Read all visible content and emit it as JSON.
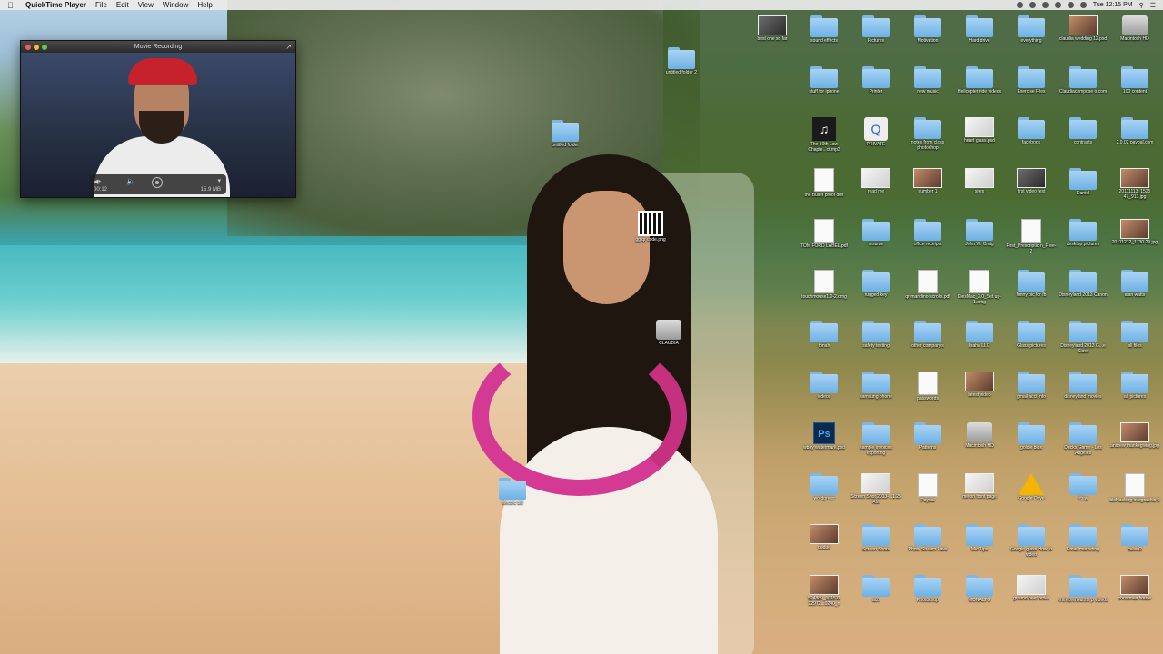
{
  "menubar": {
    "app_name": "QuickTime Player",
    "menus": [
      "File",
      "Edit",
      "View",
      "Window",
      "Help"
    ],
    "clock": "Tue 12:15 PM"
  },
  "movie_window": {
    "title": "Movie Recording",
    "elapsed": "00:12",
    "file_size": "15.9 MB"
  },
  "desktop_items": {
    "loose": [
      {
        "label": "untitled folder 2",
        "kind": "folder"
      },
      {
        "label": "untitled folder",
        "kind": "folder"
      },
      {
        "label": "gg qr code.png",
        "kind": "qr"
      },
      {
        "label": "CLAUDIA",
        "kind": "drive"
      },
      {
        "label": "electric bill",
        "kind": "folder"
      }
    ],
    "grid": [
      {
        "label": "best one so far",
        "kind": "thumb"
      },
      {
        "label": "sound effects",
        "kind": "folder"
      },
      {
        "label": "Pictures",
        "kind": "folder"
      },
      {
        "label": "Motivation",
        "kind": "folder"
      },
      {
        "label": "Hard drive",
        "kind": "folder"
      },
      {
        "label": "everything",
        "kind": "folder"
      },
      {
        "label": "claudia wedding 12.psd",
        "kind": "photo"
      },
      {
        "label": "Macintosh HD",
        "kind": "drive"
      },
      {
        "label": "stuff for iphone",
        "kind": "folder"
      },
      {
        "label": "Printer",
        "kind": "folder"
      },
      {
        "label": "new music",
        "kind": "folder"
      },
      {
        "label": "Helicopter ride videos",
        "kind": "folder"
      },
      {
        "label": "Exercise Files",
        "kind": "folder"
      },
      {
        "label": "Claudiacampose o.com",
        "kind": "folder"
      },
      {
        "label": "100 content",
        "kind": "folder"
      },
      {
        "label": "",
        "kind": "none"
      },
      {
        "label": "The 50th Law Chapte...ct.mp3",
        "kind": "music"
      },
      {
        "label": "PRIVATE",
        "kind": "quicktime"
      },
      {
        "label": "notes from class photoshop",
        "kind": "folder"
      },
      {
        "label": "heart glass.psd",
        "kind": "light"
      },
      {
        "label": "facebook",
        "kind": "folder"
      },
      {
        "label": "contracts",
        "kind": "folder"
      },
      {
        "label": "2.0.02 paypal.com",
        "kind": "folder"
      },
      {
        "label": "",
        "kind": "none"
      },
      {
        "label": "the Bullet proof diet",
        "kind": "doc"
      },
      {
        "label": "read me",
        "kind": "light"
      },
      {
        "label": "number 1",
        "kind": "photo"
      },
      {
        "label": "sites",
        "kind": "light"
      },
      {
        "label": "first video test",
        "kind": "thumb"
      },
      {
        "label": "Daniel",
        "kind": "folder"
      },
      {
        "label": "20111113_1525 47_913.jpg",
        "kind": "photo"
      },
      {
        "label": "",
        "kind": "none"
      },
      {
        "label": "TOM FORD LABEL.pdf",
        "kind": "doc"
      },
      {
        "label": "resume",
        "kind": "folder"
      },
      {
        "label": "office receipts",
        "kind": "folder"
      },
      {
        "label": "John W. Craig",
        "kind": "folder"
      },
      {
        "label": "First_Prescriptio n_Free-2",
        "kind": "doc"
      },
      {
        "label": "desktop pictures",
        "kind": "folder"
      },
      {
        "label": "20111212_1730 29.jpg",
        "kind": "photo"
      },
      {
        "label": "",
        "kind": "none"
      },
      {
        "label": "touchmouse1.0-2.dmg",
        "kind": "doc"
      },
      {
        "label": "rugged key",
        "kind": "folder"
      },
      {
        "label": "qr-mandino-scrolls.pdf",
        "kind": "doc"
      },
      {
        "label": "KiesMac_3.0_Set up-1.dmg",
        "kind": "doc"
      },
      {
        "label": "funny pic for fb",
        "kind": "folder"
      },
      {
        "label": "Disneyland 2013 Canon",
        "kind": "folder"
      },
      {
        "label": "alan watts",
        "kind": "folder"
      },
      {
        "label": "",
        "kind": "none"
      },
      {
        "label": "tonah",
        "kind": "folder"
      },
      {
        "label": "safety testing",
        "kind": "folder"
      },
      {
        "label": "other companys",
        "kind": "folder"
      },
      {
        "label": "Isaha LLC",
        "kind": "folder"
      },
      {
        "label": "Glass pictures",
        "kind": "folder"
      },
      {
        "label": "Disneyland 2013 G...e Glass",
        "kind": "folder"
      },
      {
        "label": "all files",
        "kind": "folder"
      },
      {
        "label": "",
        "kind": "none"
      },
      {
        "label": "videos",
        "kind": "folder"
      },
      {
        "label": "samsung phone",
        "kind": "folder"
      },
      {
        "label": "passwords",
        "kind": "doc"
      },
      {
        "label": "latest video",
        "kind": "photo"
      },
      {
        "label": "gmail acct info",
        "kind": "folder"
      },
      {
        "label": "disneyland movies",
        "kind": "folder"
      },
      {
        "label": "all pictures",
        "kind": "folder"
      },
      {
        "label": "",
        "kind": "none"
      },
      {
        "label": "wbay watermark.psd",
        "kind": "ps"
      },
      {
        "label": "sample invoices exporting",
        "kind": "folder"
      },
      {
        "label": "Patterns",
        "kind": "folder"
      },
      {
        "label": "Macintosh HD",
        "kind": "drive"
      },
      {
        "label": "goldie blox",
        "kind": "folder"
      },
      {
        "label": "Ducks Game - Los Angeles",
        "kind": "folder"
      },
      {
        "label": "andrew thanksgiving.jpg",
        "kind": "photo"
      },
      {
        "label": "",
        "kind": "none"
      },
      {
        "label": "wordpress",
        "kind": "folder"
      },
      {
        "label": "Screen Shot 2013-...1.25 AM",
        "kind": "light"
      },
      {
        "label": "Paypal",
        "kind": "doc"
      },
      {
        "label": "me on front page",
        "kind": "light"
      },
      {
        "label": "Google Drive",
        "kind": "gdrive"
      },
      {
        "label": "ebay",
        "kind": "folder"
      },
      {
        "label": "bioHacking-infographic-2",
        "kind": "doc"
      },
      {
        "label": "",
        "kind": "none"
      },
      {
        "label": "dudue",
        "kind": "photo"
      },
      {
        "label": "Screen Shots",
        "kind": "folder"
      },
      {
        "label": "Photo Stream Favs",
        "kind": "folder"
      },
      {
        "label": "Mic Tips",
        "kind": "folder"
      },
      {
        "label": "Google glass How to video",
        "kind": "folder"
      },
      {
        "label": "Email marketing",
        "kind": "folder"
      },
      {
        "label": "calvin2",
        "kind": "folder"
      },
      {
        "label": "",
        "kind": "none"
      },
      {
        "label": "524889_101511 22972...0240_n",
        "kind": "photo"
      },
      {
        "label": "aco",
        "kind": "folder"
      },
      {
        "label": "Photoshop",
        "kind": "folder"
      },
      {
        "label": "MONALTO",
        "kind": "folder"
      },
      {
        "label": "ground beef order",
        "kind": "light"
      },
      {
        "label": "entrepreneurshi p videos",
        "kind": "folder"
      },
      {
        "label": "christmas house",
        "kind": "photo"
      },
      {
        "label": "",
        "kind": "none"
      }
    ]
  }
}
